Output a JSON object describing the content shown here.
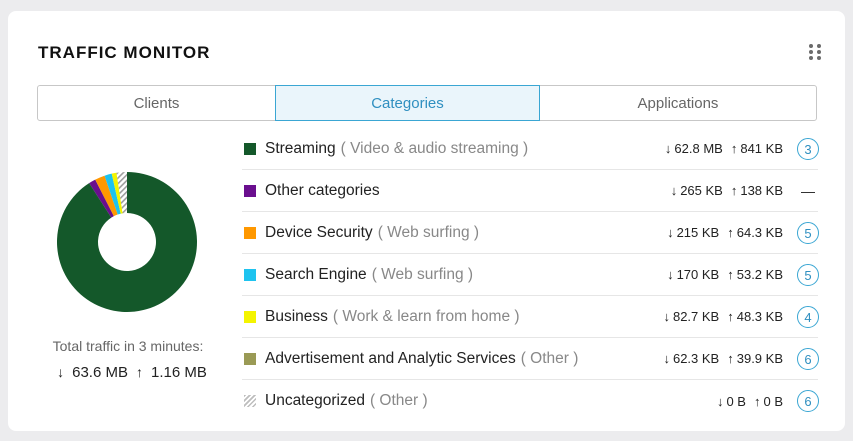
{
  "widget": {
    "title": "TRAFFIC MONITOR"
  },
  "tabs": [
    {
      "label": "Clients",
      "active": false
    },
    {
      "label": "Categories",
      "active": true
    },
    {
      "label": "Applications",
      "active": false
    }
  ],
  "summary": {
    "label": "Total traffic in 3 minutes:",
    "down": "63.6 MB",
    "up": "1.16 MB",
    "down_arrow": "↓",
    "up_arrow": "↑"
  },
  "categories": [
    {
      "name": "Streaming",
      "sub": "( Video & audio streaming )",
      "color": "#14582a",
      "down": "62.8 MB",
      "up": "841 KB",
      "count": "3"
    },
    {
      "name": "Other categories",
      "sub": "",
      "color": "#6a0e8e",
      "down": "265 KB",
      "up": "138 KB",
      "count": "—"
    },
    {
      "name": "Device Security",
      "sub": "( Web surfing )",
      "color": "#ff9800",
      "down": "215 KB",
      "up": "64.3 KB",
      "count": "5"
    },
    {
      "name": "Search Engine",
      "sub": "( Web surfing )",
      "color": "#1ec3ef",
      "down": "170 KB",
      "up": "53.2 KB",
      "count": "5"
    },
    {
      "name": "Business",
      "sub": "( Work & learn from home )",
      "color": "#f4f400",
      "down": "82.7 KB",
      "up": "48.3 KB",
      "count": "4"
    },
    {
      "name": "Advertisement and Analytic Services",
      "sub": "( Other )",
      "color": "#9a9a55",
      "down": "62.3 KB",
      "up": "39.9 KB",
      "count": "6"
    },
    {
      "name": "Uncategorized",
      "sub": "( Other )",
      "color": "hatch",
      "down": "0 B",
      "up": "0 B",
      "count": "6"
    }
  ],
  "chart_data": {
    "type": "pie",
    "categories": [
      "Streaming",
      "Other categories",
      "Device Security",
      "Search Engine",
      "Business",
      "Advertisement and Analytic Services",
      "Uncategorized"
    ],
    "values": [
      0.909,
      0.016,
      0.023,
      0.017,
      0.011,
      0.0,
      0.024
    ],
    "colors": [
      "#14582a",
      "#6a0e8e",
      "#ff9800",
      "#1ec3ef",
      "#f4f400",
      "#9a9a55",
      "hatch"
    ]
  }
}
